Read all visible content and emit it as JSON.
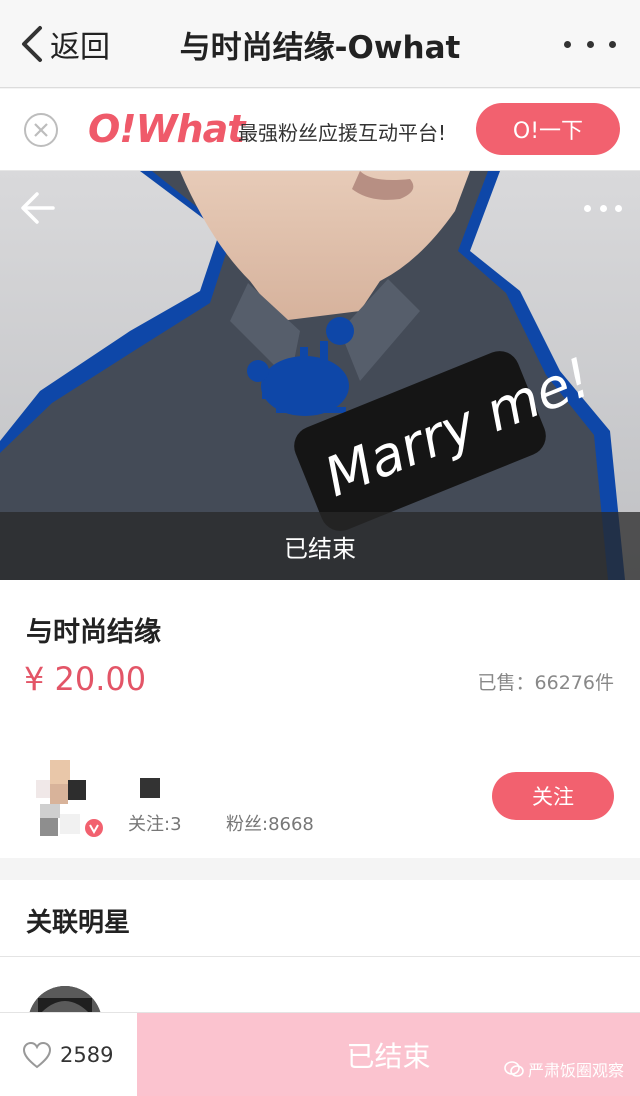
{
  "navbar": {
    "back_label": "返回",
    "title": "与时尚结缘-Owhat"
  },
  "ad": {
    "logo": "O!What",
    "slogan": "最强粉丝应援互动平台!",
    "button_label": "O!一下"
  },
  "hero": {
    "status_label": "已结束",
    "sign_text": "Marry me!",
    "accent_color": "#0e47a8"
  },
  "product": {
    "title": "与时尚结缘",
    "price": "¥ 20.00",
    "sold": "已售：66276件"
  },
  "seller": {
    "following": "关注:3",
    "fans": "粉丝:8668",
    "follow_label": "关注"
  },
  "related": {
    "title": "关联明星"
  },
  "bottom": {
    "like_count": "2589",
    "end_label": "已结束",
    "watermark": "严肃饭圈观察"
  },
  "colors": {
    "accent": "#f2616f",
    "price": "#e35567",
    "ended_button": "#fbc3cf"
  }
}
